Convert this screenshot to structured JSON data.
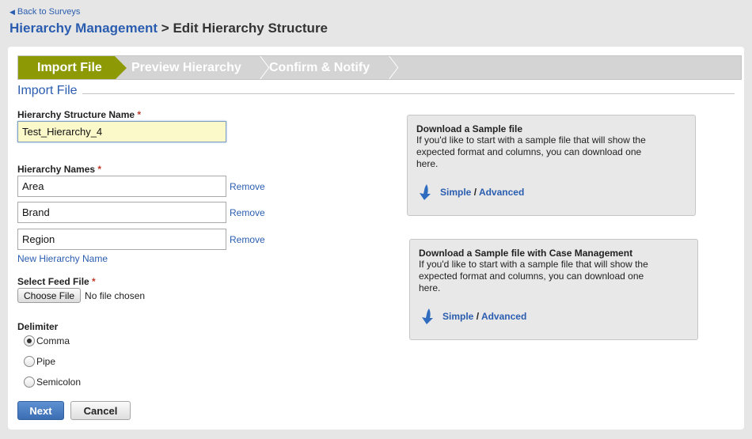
{
  "nav": {
    "back_label": "Back to Surveys"
  },
  "header": {
    "crumb": "Hierarchy Management",
    "separator": " > ",
    "title": "Edit Hierarchy Structure"
  },
  "wizard": {
    "steps": [
      {
        "label": "Import File",
        "state": "active"
      },
      {
        "label": "Preview Hierarchy",
        "state": "upcoming"
      },
      {
        "label": "Confirm & Notify",
        "state": "upcoming"
      }
    ]
  },
  "section": {
    "title": "Import File"
  },
  "form": {
    "structure_name_label": "Hierarchy Structure Name",
    "required_mark": "*",
    "structure_name_value": "Test_Hierarchy_4",
    "hierarchy_names_label": "Hierarchy Names",
    "hierarchy_names": [
      {
        "value": "Area",
        "remove_label": "Remove"
      },
      {
        "value": "Brand",
        "remove_label": "Remove"
      },
      {
        "value": "Region",
        "remove_label": "Remove"
      }
    ],
    "new_name_link": "New Hierarchy Name",
    "feed_file_label": "Select Feed File",
    "choose_file_label": "Choose File",
    "file_status": "No file chosen",
    "delimiter_label": "Delimiter",
    "delimiters": [
      {
        "label": "Comma",
        "checked": true
      },
      {
        "label": "Pipe",
        "checked": false
      },
      {
        "label": "Semicolon",
        "checked": false
      }
    ],
    "next_label": "Next",
    "cancel_label": "Cancel"
  },
  "sample_boxes": [
    {
      "title": "Download a Sample file",
      "description": "If you'd like to start with a sample file that will show the expected format and columns, you can download one here.",
      "simple_label": "Simple",
      "divider": "/",
      "advanced_label": "Advanced",
      "icon": "download-arrow-icon"
    },
    {
      "title": "Download a Sample file with Case Management",
      "description": "If you'd like to start with a sample file that will show the expected format and columns, you can download one here.",
      "simple_label": "Simple",
      "divider": "/",
      "advanced_label": "Advanced",
      "icon": "download-arrow-icon"
    }
  ],
  "colors": {
    "link": "#2a5db0",
    "wizard_active": "#8d9a06",
    "wizard_inactive": "#d4d4d4",
    "primary_button": "#3b6db3",
    "required": "#c0392b",
    "input_highlight": "#fbf9c9"
  }
}
